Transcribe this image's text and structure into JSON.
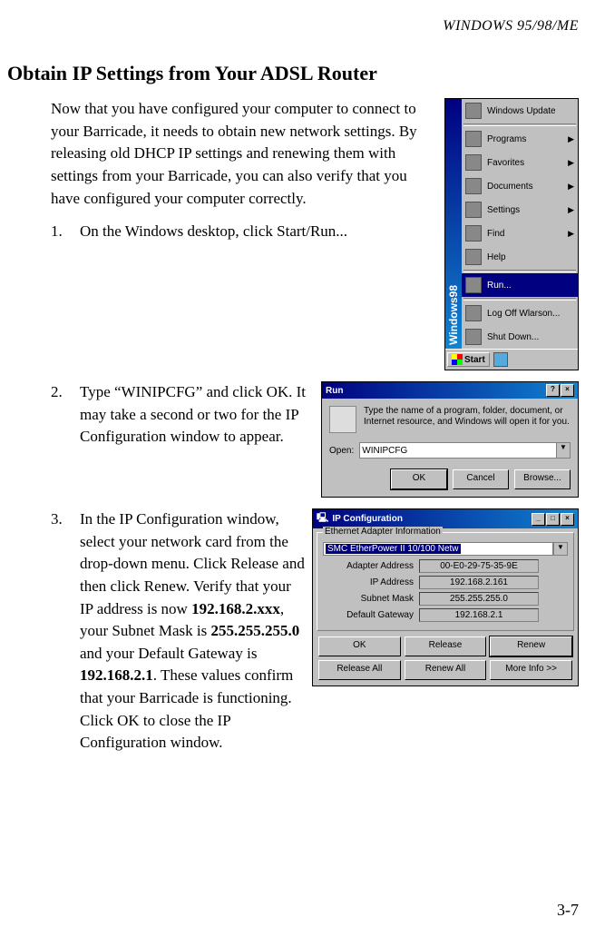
{
  "header": {
    "right": "WINDOWS 95/98/ME"
  },
  "section_title": "Obtain IP Settings from Your ADSL Router",
  "intro": "Now that you have configured your computer to connect to your Barricade, it needs to obtain new network settings. By releasing old DHCP IP settings and renewing them with settings from your Barricade, you can also verify that you have configured your computer correctly.",
  "steps": {
    "s1": {
      "num": "1.",
      "text": "On the Windows desktop, click Start/Run..."
    },
    "s2": {
      "num": "2.",
      "text": "Type “WINIPCFG” and click OK. It may take a second or two for the IP Configuration window to appear."
    },
    "s3": {
      "num": "3.",
      "pre": "In the IP Configuration window, select your network card from the drop-down menu. Click Release and then click Renew. Verify that your IP address is now ",
      "ip": "192.168.2.xxx",
      "mid1": ", your Subnet Mask is ",
      "mask": "255.255.255.0",
      "mid2": " and your Default Gateway is ",
      "gw": "192.168.2.1",
      "post": ". These values confirm that your Barricade is functioning. Click OK to close the IP Configuration window."
    }
  },
  "startmenu": {
    "stripe": "Windows98",
    "items": [
      {
        "label": "Windows Update"
      },
      {
        "label": "Programs",
        "arrow": true
      },
      {
        "label": "Favorites",
        "arrow": true
      },
      {
        "label": "Documents",
        "arrow": true
      },
      {
        "label": "Settings",
        "arrow": true
      },
      {
        "label": "Find",
        "arrow": true
      },
      {
        "label": "Help"
      },
      {
        "label": "Run...",
        "selected": true
      },
      {
        "label": "Log Off Wlarson..."
      },
      {
        "label": "Shut Down..."
      }
    ],
    "start_btn": "Start"
  },
  "run_dialog": {
    "title": "Run",
    "desc": "Type the name of a program, folder, document, or Internet resource, and Windows will open it for you.",
    "open_label": "Open:",
    "input_value": "WINIPCFG",
    "buttons": {
      "ok": "OK",
      "cancel": "Cancel",
      "browse": "Browse..."
    }
  },
  "ipconfig": {
    "title": "IP Configuration",
    "group_label": "Ethernet Adapter Information",
    "adapter_selected": "SMC EtherPower II 10/100 Netw",
    "rows": {
      "adapter_addr_label": "Adapter Address",
      "adapter_addr_value": "00-E0-29-75-35-9E",
      "ip_label": "IP Address",
      "ip_value": "192.168.2.161",
      "mask_label": "Subnet Mask",
      "mask_value": "255.255.255.0",
      "gw_label": "Default Gateway",
      "gw_value": "192.168.2.1"
    },
    "buttons": {
      "ok": "OK",
      "release": "Release",
      "renew": "Renew",
      "release_all": "Release All",
      "renew_all": "Renew All",
      "more": "More Info >>"
    }
  },
  "page_num": "3-7"
}
